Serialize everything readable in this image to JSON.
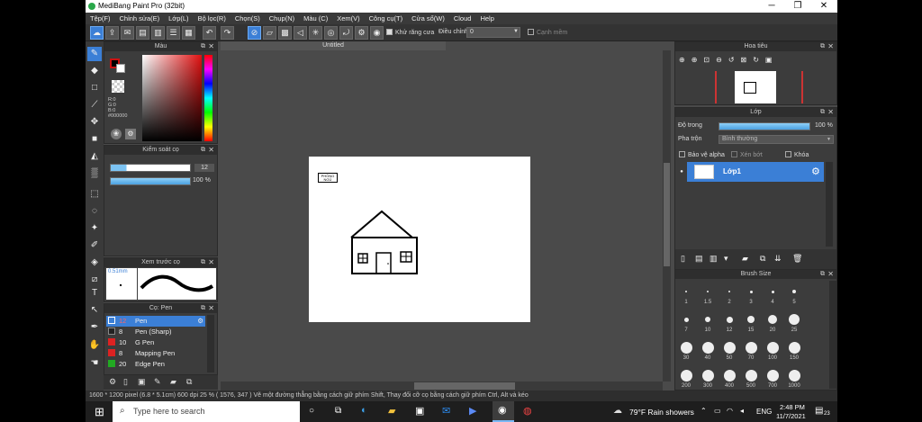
{
  "window": {
    "title": "MediBang Paint Pro (32bit)",
    "minimize": "─",
    "maximize": "❐",
    "close": "✕"
  },
  "menu": [
    "Tệp(F)",
    "Chỉnh sửa(E)",
    "Lớp(L)",
    "Bộ lọc(R)",
    "Chọn(S)",
    "Chụp(N)",
    "Màu (C)",
    "Xem(V)",
    "Công cụ(T)",
    "Cửa sổ(W)",
    "Cloud",
    "Help"
  ],
  "toolbar": {
    "antialias": "Khử răng cưa",
    "adjust": "Điều chỉnh",
    "adjust_value": "0",
    "edge": "Cạnh mềm"
  },
  "color_panel": {
    "title": "Màu",
    "r": "R:0",
    "g": "G:0",
    "b": "B:0",
    "hex": "#000000",
    "primary": "#000000",
    "accent": "#cc1111"
  },
  "brush_control": {
    "title": "Kiểm soát cọ",
    "size": "12",
    "opacity": "100 %"
  },
  "brush_preview": {
    "title": "Xem trước cọ",
    "size": "0.51mm"
  },
  "brush_list": {
    "title": "Cọ: Pen",
    "items": [
      {
        "size": "12",
        "name": "Pen",
        "color": "#3b7fd6"
      },
      {
        "size": "8",
        "name": "Pen (Sharp)",
        "color": "#222222"
      },
      {
        "size": "10",
        "name": "G Pen",
        "color": "#dd2222"
      },
      {
        "size": "8",
        "name": "Mapping Pen",
        "color": "#dd2222"
      },
      {
        "size": "20",
        "name": "Edge Pen",
        "color": "#22aa22"
      }
    ]
  },
  "canvas": {
    "tab": "Untitled",
    "sign": "PHÒNG\nNGỦ"
  },
  "navigator": {
    "title": "Hoa tiêu"
  },
  "layer_panel": {
    "title": "Lớp",
    "opacity_label": "Độ trong",
    "opacity_value": "100 %",
    "blend_label": "Pha trộn",
    "blend_value": "Bình thường",
    "protect_alpha": "Bảo vệ alpha",
    "clip": "Xén bớt",
    "lock": "Khóa",
    "layer_name": "Lớp1"
  },
  "brush_size": {
    "title": "Brush Size",
    "sizes": [
      "1",
      "1.5",
      "2",
      "3",
      "4",
      "5",
      "7",
      "10",
      "12",
      "15",
      "20",
      "25",
      "30",
      "40",
      "50",
      "70",
      "100",
      "150",
      "200",
      "300",
      "400",
      "500",
      "700",
      "1000"
    ]
  },
  "status": "1600 * 1200 pixel  (6.8 * 5.1cm)  600 dpi  25 %  ( 1576, 347 )  Vẽ một đường thẳng bằng cách giữ phím Shift, Thay đổi cỡ cọ bằng cách giữ phím Ctrl, Alt và kéo",
  "taskbar": {
    "search": "Type here to search",
    "weather": "79°F  Rain showers",
    "lang": "ENG",
    "time": "2:48 PM",
    "date": "11/7/2021",
    "notif": "23"
  }
}
